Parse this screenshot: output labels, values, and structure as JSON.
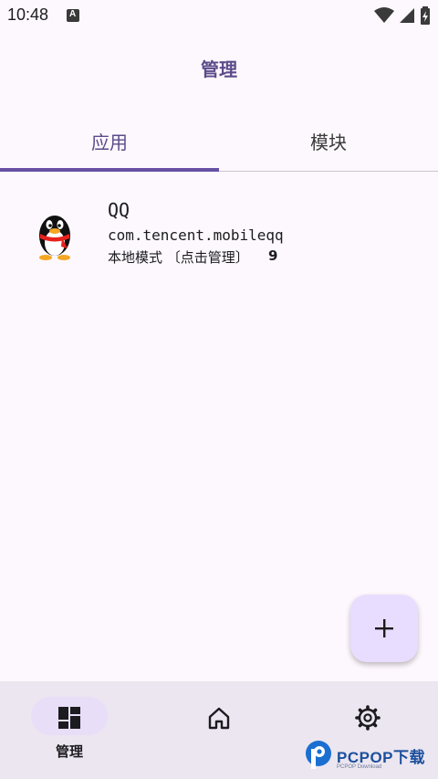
{
  "status_bar": {
    "time": "10:48",
    "icons": [
      "accessibility-a-icon",
      "wifi-icon",
      "signal-icon",
      "battery-icon"
    ]
  },
  "app_bar": {
    "title": "管理"
  },
  "tabs": [
    {
      "label": "应用",
      "selected": true
    },
    {
      "label": "模块",
      "selected": false
    }
  ],
  "app_list": [
    {
      "name": "QQ",
      "package": "com.tencent.mobileqq",
      "mode": "本地模式 〔点击管理〕",
      "count": "9",
      "icon": "qq-penguin-icon"
    }
  ],
  "fab": {
    "icon": "plus-icon"
  },
  "bottom_nav": [
    {
      "label": "管理",
      "icon": "dashboard-icon",
      "selected": true
    },
    {
      "label": "",
      "icon": "home-icon",
      "selected": false
    },
    {
      "label": "",
      "icon": "gear-icon",
      "selected": false
    }
  ],
  "watermark": {
    "text": "PCPOP下载",
    "subtext": "PCPOP Download"
  },
  "colors": {
    "accent": "#6750a4",
    "title": "#5b4b8a",
    "background": "#fdf8fd",
    "nav_background": "#ece6f0",
    "fab_background": "#e8ddff"
  }
}
